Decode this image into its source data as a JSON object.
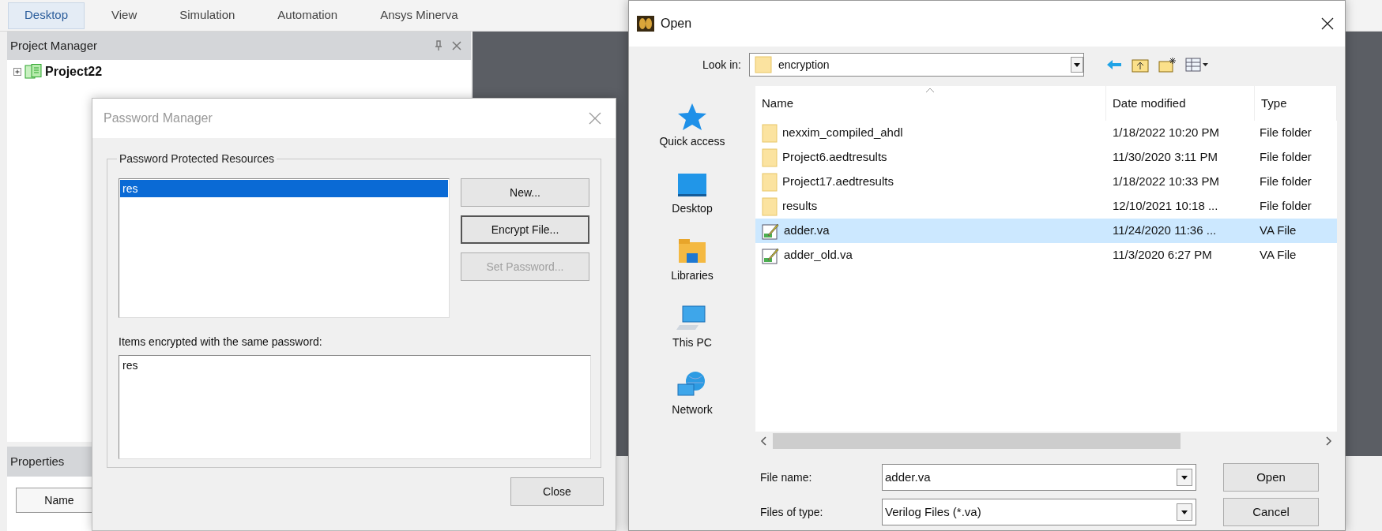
{
  "ribbon_tabs": [
    {
      "label": "Desktop",
      "selected": true
    },
    {
      "label": "View",
      "selected": false
    },
    {
      "label": "Simulation",
      "selected": false
    },
    {
      "label": "Automation",
      "selected": false
    },
    {
      "label": "Ansys Minerva",
      "selected": false
    }
  ],
  "project_manager": {
    "title": "Project Manager",
    "tree": [
      {
        "label": "Project22",
        "expanded": false
      }
    ]
  },
  "properties": {
    "title": "Properties",
    "columns": [
      "Name"
    ]
  },
  "password_manager": {
    "title": "Password Manager",
    "group_label": "Password Protected Resources",
    "resources": [
      {
        "label": "res",
        "selected": true
      }
    ],
    "buttons": [
      {
        "label": "New...",
        "disabled": false,
        "focused": false
      },
      {
        "label": "Encrypt File...",
        "disabled": false,
        "focused": true
      },
      {
        "label": "Set Password...",
        "disabled": true,
        "focused": false
      }
    ],
    "items_label": "Items encrypted with the same password:",
    "items": [
      "res"
    ],
    "close_button": "Close"
  },
  "open_dialog": {
    "title": "Open",
    "look_in_label": "Look in:",
    "look_in_value": "encryption",
    "places": [
      {
        "label": "Quick access",
        "kind": "star"
      },
      {
        "label": "Desktop",
        "kind": "desktop"
      },
      {
        "label": "Libraries",
        "kind": "library"
      },
      {
        "label": "This PC",
        "kind": "computer"
      },
      {
        "label": "Network",
        "kind": "network"
      }
    ],
    "columns": [
      "Name",
      "Date modified",
      "Type"
    ],
    "files": [
      {
        "name": "nexxim_compiled_ahdl",
        "date": "1/18/2022 10:20 PM",
        "type": "File folder",
        "kind": "folder",
        "selected": false
      },
      {
        "name": "Project6.aedtresults",
        "date": "11/30/2020 3:11 PM",
        "type": "File folder",
        "kind": "folder",
        "selected": false
      },
      {
        "name": "Project17.aedtresults",
        "date": "1/18/2022 10:33 PM",
        "type": "File folder",
        "kind": "folder",
        "selected": false
      },
      {
        "name": "results",
        "date": "12/10/2021 10:18 ...",
        "type": "File folder",
        "kind": "folder",
        "selected": false
      },
      {
        "name": "adder.va",
        "date": "11/24/2020 11:36 ...",
        "type": "VA File",
        "kind": "file",
        "selected": true
      },
      {
        "name": "adder_old.va",
        "date": "11/3/2020 6:27 PM",
        "type": "VA File",
        "kind": "file",
        "selected": false
      }
    ],
    "file_name_label": "File name:",
    "file_name_value": "adder.va",
    "file_type_label": "Files of type:",
    "file_type_value": "Verilog Files (*.va)",
    "open_button": "Open",
    "cancel_button": "Cancel"
  }
}
